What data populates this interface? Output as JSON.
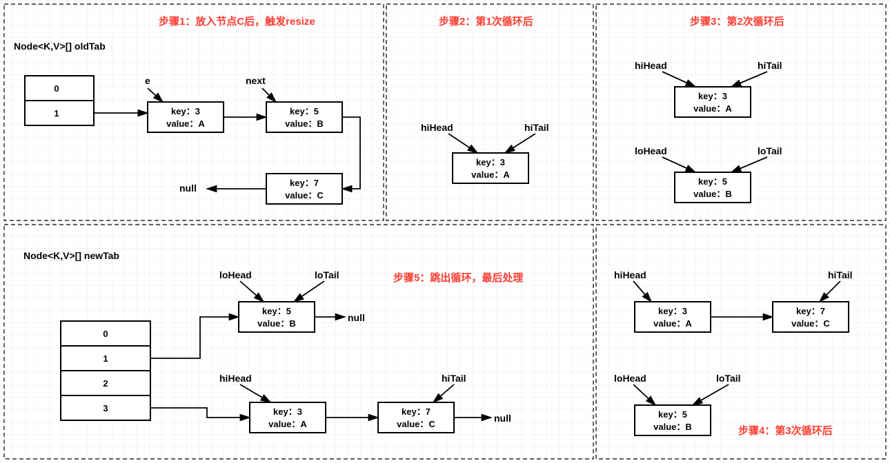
{
  "steps": {
    "s1": "步骤1：放入节点C后，触发resize",
    "s2": "步骤2：第1次循环后",
    "s3": "步骤3：第2次循环后",
    "s4": "步骤4：第3次循环后",
    "s5": "步骤5：跳出循环，最后处理"
  },
  "labels": {
    "oldTab": "Node<K,V>[] oldTab",
    "newTab": "Node<K,V>[] newTab",
    "e": "e",
    "next": "next",
    "null": "null",
    "hiHead": "hiHead",
    "hiTail": "hiTail",
    "loHead": "loHead",
    "loTail": "loTail"
  },
  "cells": {
    "c0": "0",
    "c1": "1",
    "c2": "2",
    "c3": "3"
  },
  "nodes": {
    "k3": "key：3",
    "v3": "value：A",
    "k5": "key：5",
    "v5": "value：B",
    "k7": "key：7",
    "v7": "value：C"
  }
}
